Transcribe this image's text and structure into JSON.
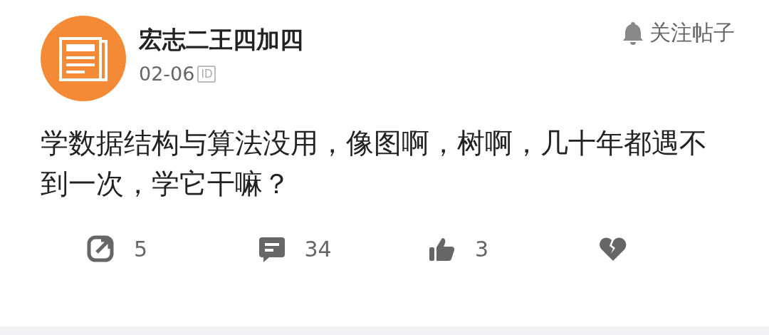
{
  "post": {
    "author": "宏志二王四加四",
    "date": "02-06",
    "id_badge": "ID",
    "follow_button": "关注帖子",
    "body": "学数据结构与算法没用，像图啊，树啊，几十年都遇不到一次，学它干嘛？"
  },
  "actions": [
    {
      "kind": "share",
      "count": "5"
    },
    {
      "kind": "comment",
      "count": "34"
    },
    {
      "kind": "like",
      "count": "3"
    },
    {
      "kind": "dislike"
    }
  ]
}
